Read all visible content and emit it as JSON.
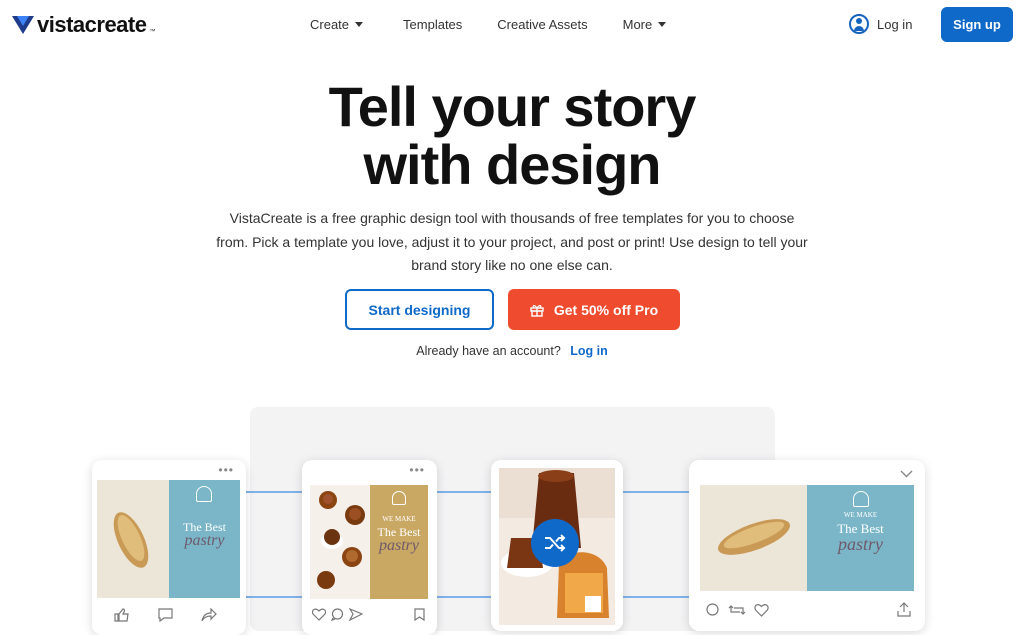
{
  "header": {
    "logo_text": "vistacreate",
    "logo_tm": "™",
    "nav": [
      {
        "label": "Create",
        "has_caret": true
      },
      {
        "label": "Templates",
        "has_caret": false
      },
      {
        "label": "Creative Assets",
        "has_caret": false
      },
      {
        "label": "More",
        "has_caret": true
      }
    ],
    "login_label": "Log in",
    "signup_label": "Sign up"
  },
  "hero": {
    "title_line1": "Tell your story",
    "title_line2": "with design",
    "description": "VistaCreate is a free graphic design tool with thousands of free templates for you to choose from. Pick a template you love, adjust it to your project, and post or print! Use design to tell your brand story like no one else can.",
    "start_button": "Start designing",
    "pro_button": "Get 50% off Pro",
    "already_text": "Already have an account?",
    "already_link": "Log in"
  },
  "showcase": {
    "card_text": {
      "small_heading": "WE MAKE",
      "title": "The Best",
      "script": "pastry"
    }
  },
  "colors": {
    "brand_blue": "#0f69c9",
    "promo_red": "#ef4b2e",
    "teal_panel": "#7ab6c8",
    "mustard_panel": "#c9a864"
  }
}
